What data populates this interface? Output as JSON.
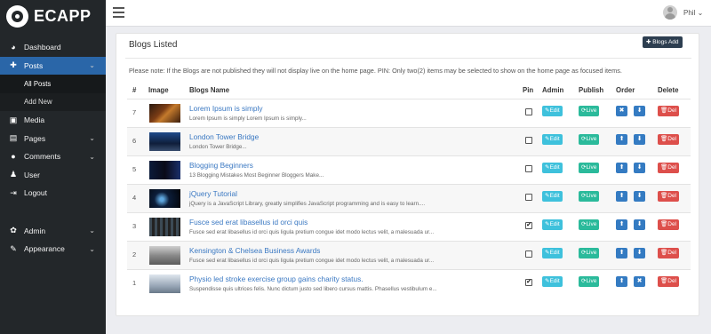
{
  "app": {
    "logo": "ECAPP"
  },
  "sidebar": {
    "items": [
      {
        "label": "Dashboard",
        "icon": "dashboard-icon",
        "glyph": "◕"
      },
      {
        "label": "Posts",
        "icon": "pin-icon",
        "glyph": "✚"
      },
      {
        "label": "Media",
        "icon": "image-icon",
        "glyph": "▣"
      },
      {
        "label": "Pages",
        "icon": "file-icon",
        "glyph": "▤"
      },
      {
        "label": "Comments",
        "icon": "comment-icon",
        "glyph": "●"
      },
      {
        "label": "User",
        "icon": "user-icon",
        "glyph": "♟"
      },
      {
        "label": "Logout",
        "icon": "logout-icon",
        "glyph": "⇥"
      },
      {
        "label": "Admin",
        "icon": "gear-icon",
        "glyph": "✿"
      },
      {
        "label": "Appearance",
        "icon": "brush-icon",
        "glyph": "✎"
      }
    ],
    "sub": [
      "All Posts",
      "Add New"
    ],
    "active_color": "#2a66a8"
  },
  "topbar": {
    "user": "Phil ⌄"
  },
  "panel": {
    "title": "Blogs Listed",
    "add_button": "✚ Blogs Add",
    "note": "Please note: If the Blogs are not published they will not display live on the home page. PIN: Only two(2) items may be selected to show on the home page as focused items.",
    "headers": {
      "num": "#",
      "image": "Image",
      "blogs": "Blogs Name",
      "pin": "Pin",
      "admin": "Admin",
      "publish": "Publish",
      "order": "Order",
      "delete": "Delete"
    },
    "labels": {
      "edit": "✎Edit",
      "live": "⟳Live",
      "del": "🗑Del"
    },
    "rows": [
      {
        "num": "7",
        "title": "Lorem Ipsum is simply",
        "desc": "Lorem Ipsum is simply Lorem Ipsum is simply...",
        "pin": "",
        "o1": "✖",
        "o2": "⬇"
      },
      {
        "num": "6",
        "title": "London Tower Bridge",
        "desc": "London Tower Bridge...",
        "pin": "",
        "o1": "⬆",
        "o2": "⬇"
      },
      {
        "num": "5",
        "title": "Blogging Beginners",
        "desc": "13 Blogging Mistakes Most Beginner Bloggers Make...",
        "pin": "",
        "o1": "⬆",
        "o2": "⬇"
      },
      {
        "num": "4",
        "title": "jQuery Tutorial",
        "desc": "jQuery is a JavaScript Library, greatly simplifies JavaScript programming and is easy to learn....",
        "pin": "",
        "o1": "⬆",
        "o2": "⬇"
      },
      {
        "num": "3",
        "title": "Fusce sed erat libasellus id orci quis",
        "desc": "Fusce sed erat libasellus id orci quis ligula pretium congue idet modo lectus velit, a malesuada ur...",
        "pin": "✔",
        "o1": "⬆",
        "o2": "⬇"
      },
      {
        "num": "2",
        "title": "Kensington & Chelsea Business Awards",
        "desc": "Fusce sed erat libasellus id orci quis ligula pretium congue idet modo lectus velit, a malesuada ur...",
        "pin": "",
        "o1": "⬆",
        "o2": "⬇"
      },
      {
        "num": "1",
        "title": "Physio led stroke exercise group gains charity status.",
        "desc": "Suspendisse quis ultrices felis. Nunc dictum justo sed libero cursus mattis. Phasellus vestibulum e...",
        "pin": "✔",
        "o1": "⬆",
        "o2": "✖"
      }
    ]
  }
}
